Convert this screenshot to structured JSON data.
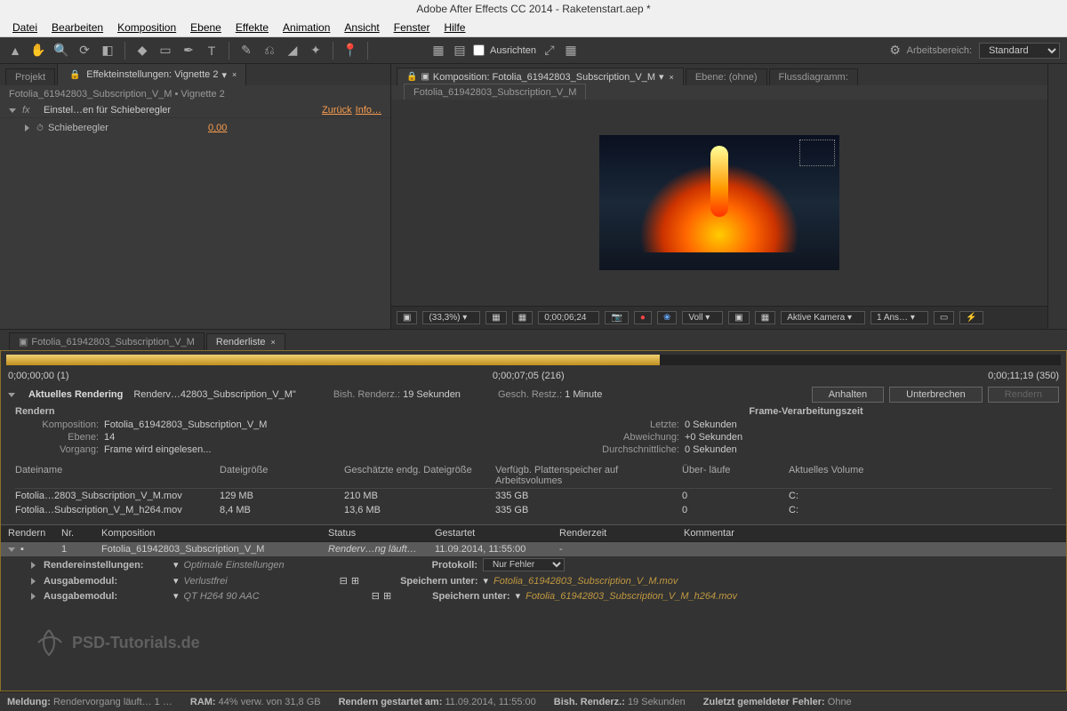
{
  "title": "Adobe After Effects CC 2014 - Raketenstart.aep *",
  "menu": [
    "Datei",
    "Bearbeiten",
    "Komposition",
    "Ebene",
    "Effekte",
    "Animation",
    "Ansicht",
    "Fenster",
    "Hilfe"
  ],
  "toolbar": {
    "ausrichten": "Ausrichten",
    "workspace_label": "Arbeitsbereich:",
    "workspace_value": "Standard"
  },
  "left_panel": {
    "tabs": {
      "project": "Projekt",
      "effect_controls": "Effekteinstellungen: Vignette 2"
    },
    "breadcrumb": "Fotolia_61942803_Subscription_V_M • Vignette 2",
    "effect_name": "Einstel…en für Schieberegler",
    "effect_reset": "Zurück",
    "effect_info": "Info…",
    "prop_name": "Schieberegler",
    "prop_value": "0,00"
  },
  "comp_panel": {
    "tab": "Komposition: Fotolia_61942803_Subscription_V_M",
    "tab_ebene": "Ebene: (ohne)",
    "tab_fluss": "Flussdiagramm:",
    "subtab": "Fotolia_61942803_Subscription_V_M",
    "zoom": "(33,3%)",
    "timecode": "0;00;06;24",
    "voll": "Voll",
    "camera": "Aktive Kamera",
    "views": "1 Ans…"
  },
  "lower_tabs": {
    "comp_tab": "Fotolia_61942803_Subscription_V_M",
    "render_tab": "Renderliste"
  },
  "time_row": {
    "start": "0;00;00;00 (1)",
    "current": "0;00;07;05 (216)",
    "end": "0;00;11;19 (350)"
  },
  "render_header": {
    "title": "Aktuelles Rendering",
    "rendering": "Renderv…42803_Subscription_V_M\"",
    "elapsed_label": "Bish. Renderz.:",
    "elapsed_value": "19 Sekunden",
    "remaining_label": "Gesch. Restz.:",
    "remaining_value": "1 Minute",
    "btn_pause": "Anhalten",
    "btn_stop": "Unterbrechen",
    "btn_render": "Rendern"
  },
  "render_details": {
    "left_title": "Rendern",
    "rows_left": [
      {
        "k": "Komposition:",
        "v": "Fotolia_61942803_Subscription_V_M"
      },
      {
        "k": "Ebene:",
        "v": "14"
      },
      {
        "k": "Vorgang:",
        "v": "Frame wird eingelesen..."
      }
    ],
    "right_title": "Frame-Verarbeitungszeit",
    "rows_right": [
      {
        "k": "Letzte:",
        "v": "0 Sekunden"
      },
      {
        "k": "Abweichung:",
        "v": "+0 Sekunden"
      },
      {
        "k": "Durchschnittliche:",
        "v": "0 Sekunden"
      }
    ]
  },
  "file_table": {
    "headers": [
      "Dateiname",
      "Dateigröße",
      "Geschätzte endg. Dateigröße",
      "Verfügb. Plattenspeicher auf Arbeitsvolumes",
      "Über- läufe",
      "Aktuelles Volume"
    ],
    "rows": [
      [
        "Fotolia…2803_Subscription_V_M.mov",
        "129 MB",
        "210 MB",
        "335 GB",
        "0",
        "C:"
      ],
      [
        "Fotolia…Subscription_V_M_h264.mov",
        "8,4 MB",
        "13,6 MB",
        "335 GB",
        "0",
        "C:"
      ]
    ]
  },
  "queue": {
    "headers": [
      "Rendern",
      "Nr.",
      "Komposition",
      "Status",
      "Gestartet",
      "Renderzeit",
      "Kommentar"
    ],
    "row": {
      "nr": "1",
      "comp": "Fotolia_61942803_Subscription_V_M",
      "status": "Renderv…ng läuft…",
      "started": "11.09.2014, 11:55:00",
      "rendertime": "-"
    },
    "settings_label": "Rendereinstellungen:",
    "settings_value": "Optimale Einstellungen",
    "protokoll_label": "Protokoll:",
    "protokoll_value": "Nur Fehler",
    "output1_label": "Ausgabemodul:",
    "output1_value": "Verlustfrei",
    "output2_value": "QT H264 90 AAC",
    "save_label": "Speichern unter:",
    "file1": "Fotolia_61942803_Subscription_V_M.mov",
    "file2": "Fotolia_61942803_Subscription_V_M_h264.mov"
  },
  "watermark": "PSD-Tutorials.de",
  "statusbar": {
    "meldung_k": "Meldung:",
    "meldung_v": "Rendervorgang läuft… 1 …",
    "ram_k": "RAM:",
    "ram_v": "44% verw. von 31,8 GB",
    "started_k": "Rendern gestartet am:",
    "started_v": "11.09.2014, 11:55:00",
    "elapsed_k": "Bish. Renderz.:",
    "elapsed_v": "19 Sekunden",
    "error_k": "Zuletzt gemeldeter Fehler:",
    "error_v": "Ohne"
  }
}
